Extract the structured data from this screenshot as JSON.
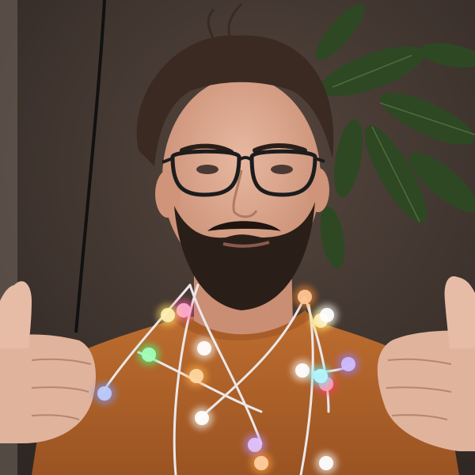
{
  "scene": {
    "subject": "man-with-string-lights",
    "colors": {
      "wall": "#3d332e",
      "wall_light": "#5a4a42",
      "sweater": "#b8682c",
      "skin": "#d9a48c",
      "hair": "#3a2a22",
      "beard": "#2a1e18",
      "glasses": "#1c1c1e",
      "plant": "#2f4a24",
      "wire": "#e8e4e6"
    },
    "bulbs": [
      {
        "color": "#ff8c2a"
      },
      {
        "color": "#ffd54a"
      },
      {
        "color": "#ffffff"
      },
      {
        "color": "#9b7cff"
      },
      {
        "color": "#ff3a6a"
      },
      {
        "color": "#ffffff"
      },
      {
        "color": "#ffb04a"
      },
      {
        "color": "#46ff7a"
      },
      {
        "color": "#7a9bff"
      },
      {
        "color": "#ffffff"
      },
      {
        "color": "#ff5aa0"
      },
      {
        "color": "#ffe066"
      },
      {
        "color": "#ffffff"
      },
      {
        "color": "#c08cff"
      },
      {
        "color": "#ffa040"
      },
      {
        "color": "#ffffff"
      },
      {
        "color": "#66f0ff"
      }
    ]
  }
}
